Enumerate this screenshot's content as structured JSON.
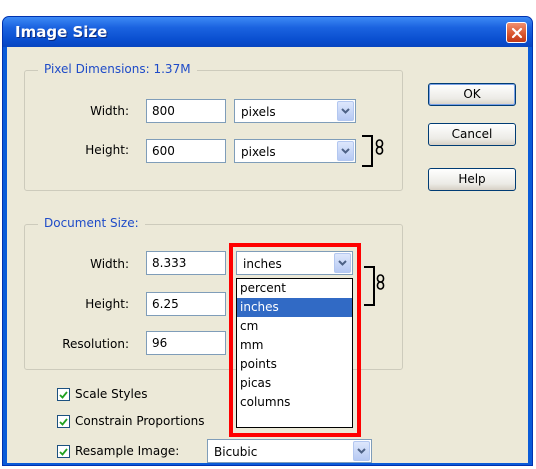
{
  "window": {
    "title": "Image Size"
  },
  "pixel_dimensions": {
    "label": "Pixel Dimensions:",
    "size": "1.37M",
    "width_label": "Width:",
    "width_value": "800",
    "width_unit": "pixels",
    "height_label": "Height:",
    "height_value": "600",
    "height_unit": "pixels"
  },
  "document_size": {
    "label": "Document Size:",
    "width_label": "Width:",
    "width_value": "8.333",
    "width_unit": "inches",
    "height_label": "Height:",
    "height_value": "6.25",
    "resolution_label": "Resolution:",
    "resolution_value": "96"
  },
  "unit_dropdown": {
    "options": [
      "percent",
      "inches",
      "cm",
      "mm",
      "points",
      "picas",
      "columns"
    ],
    "selected": "inches"
  },
  "buttons": {
    "ok": "OK",
    "cancel": "Cancel",
    "help": "Help"
  },
  "checkboxes": {
    "scale_styles": {
      "label": "Scale Styles",
      "checked": true
    },
    "constrain_proportions": {
      "label": "Constrain Proportions",
      "checked": true
    },
    "resample_image": {
      "label": "Resample Image:",
      "checked": true
    }
  },
  "resample_method": "Bicubic",
  "colors": {
    "title_bar": "#0a4fd0",
    "dialog_bg": "#ece9d8",
    "group_label": "#1e4bc8",
    "selection": "#316ac5",
    "highlight": "#ff0000"
  },
  "icons": [
    "close-icon",
    "chain-link-icon",
    "chevron-down-icon",
    "checkmark-icon"
  ]
}
